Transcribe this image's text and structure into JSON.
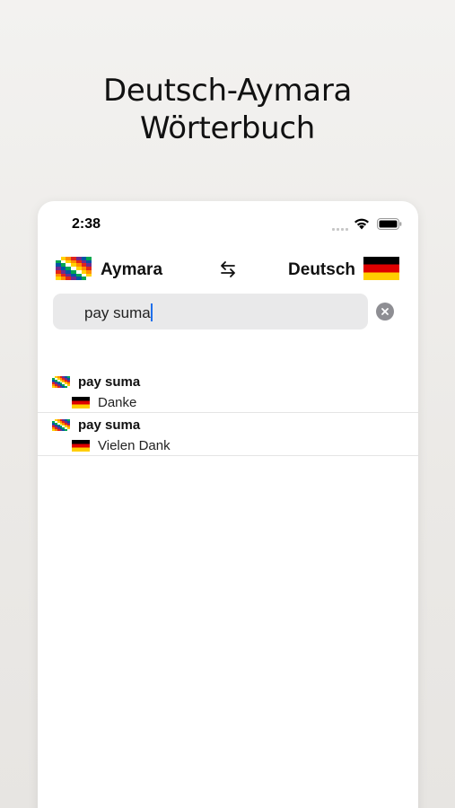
{
  "headline": {
    "line1": "Deutsch-Aymara",
    "line2": "Wörterbuch"
  },
  "status_bar": {
    "time": "2:38",
    "icons": [
      "cellular-signal-icon",
      "wifi-icon",
      "battery-icon"
    ]
  },
  "language_bar": {
    "source_language": "Aymara",
    "source_flag": "wiphala-flag-icon",
    "swap_icon": "swap-arrows-icon",
    "target_language": "Deutsch",
    "target_flag": "germany-flag-icon"
  },
  "search": {
    "value": "pay suma",
    "clear_icon": "clear-circle-icon"
  },
  "results": [
    {
      "source": "pay suma",
      "target": "Danke"
    },
    {
      "source": "pay suma",
      "target": "Vielen Dank"
    }
  ],
  "colors": {
    "background": "#eceae7",
    "search_field": "#e9e9ea",
    "caret": "#1f6feb",
    "clear_button": "#8e8e93",
    "germany_black": "#000000",
    "germany_red": "#dd0000",
    "germany_gold": "#ffce00"
  }
}
